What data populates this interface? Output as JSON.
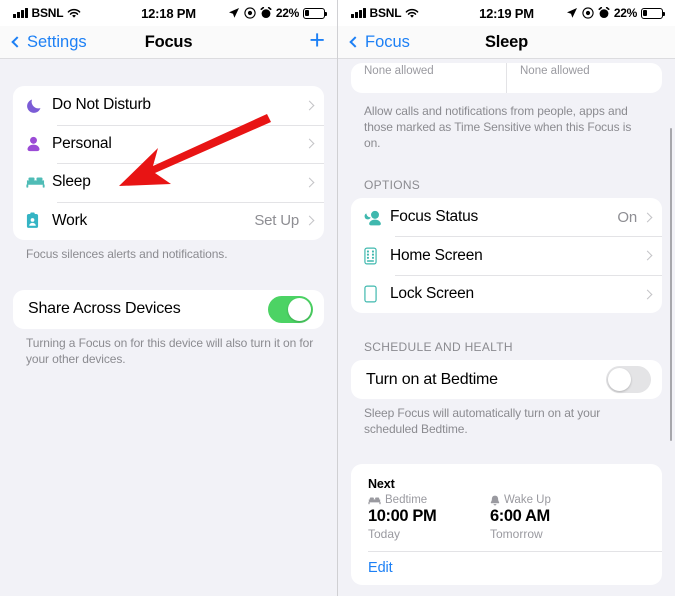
{
  "left_screen": {
    "status_bar": {
      "signal_icon": "signal-bars-icon",
      "carrier": "BSNL",
      "wifi_icon": "wifi-icon",
      "time": "12:18 PM",
      "location_icon": "location-arrow-icon",
      "focus_icon": "focus-circle-icon",
      "alarm_icon": "alarm-clock-icon",
      "battery_percent": "22%",
      "battery_icon": "battery-icon"
    },
    "nav": {
      "back_label": "Settings",
      "title": "Focus",
      "add_label": "+"
    },
    "focus_list": [
      {
        "icon": "moon-icon",
        "label": "Do Not Disturb",
        "value": "",
        "icon_color": "#7b5cd6"
      },
      {
        "icon": "person-icon",
        "label": "Personal",
        "value": "",
        "icon_color": "#9b4bd6"
      },
      {
        "icon": "bed-icon",
        "label": "Sleep",
        "value": "",
        "icon_color": "#4fbcb6"
      },
      {
        "icon": "badge-icon",
        "label": "Work",
        "value": "Set Up",
        "icon_color": "#35b4c4"
      }
    ],
    "focus_footnote": "Focus silences alerts and notifications.",
    "share": {
      "label": "Share Across Devices",
      "toggle_state": "on",
      "toggle_color": "#4cd364"
    },
    "share_footnote": "Turning a Focus on for this device will also turn it on for your other devices."
  },
  "right_screen": {
    "status_bar": {
      "signal_icon": "signal-bars-icon",
      "carrier": "BSNL",
      "wifi_icon": "wifi-icon",
      "time": "12:19 PM",
      "location_icon": "location-arrow-icon",
      "focus_icon": "focus-circle-icon",
      "alarm_icon": "alarm-clock-icon",
      "battery_percent": "22%",
      "battery_icon": "battery-icon"
    },
    "nav": {
      "back_label": "Focus",
      "title": "Sleep"
    },
    "allow_peek": {
      "left_text": "None allowed",
      "right_text": "None allowed"
    },
    "allow_footnote": "Allow calls and notifications from people, apps and those marked as Time Sensitive when this Focus is on.",
    "options_header": "OPTIONS",
    "options_list": [
      {
        "icon": "focus-status-icon",
        "label": "Focus Status",
        "value": "On",
        "icon_color": "#4fbcb6"
      },
      {
        "icon": "home-screen-icon",
        "label": "Home Screen",
        "value": "",
        "icon_color": "#4fbcb6"
      },
      {
        "icon": "lock-screen-icon",
        "label": "Lock Screen",
        "value": "",
        "icon_color": "#4fbcb6"
      }
    ],
    "schedule_header": "SCHEDULE AND HEALTH",
    "bedtime": {
      "label": "Turn on at Bedtime",
      "toggle_state": "off",
      "toggle_color": "#e4e4e6"
    },
    "bedtime_footnote": "Sleep Focus will automatically turn on at your scheduled Bedtime.",
    "next_card": {
      "title": "Next",
      "bedtime_icon": "bed-icon",
      "bedtime_label": "Bedtime",
      "bedtime_time": "10:00 PM",
      "bedtime_day": "Today",
      "wakeup_icon": "bell-icon",
      "wakeup_label": "Wake Up",
      "wakeup_time": "6:00 AM",
      "wakeup_day": "Tomorrow",
      "edit_label": "Edit"
    }
  },
  "annotations": {
    "arrow_color": "#e81414",
    "left_arrow": {
      "name": "sleep-row-arrow",
      "points_to": "Sleep"
    },
    "right_arrow": {
      "name": "bedtime-toggle-arrow",
      "points_to": "Turn on at Bedtime toggle"
    }
  }
}
